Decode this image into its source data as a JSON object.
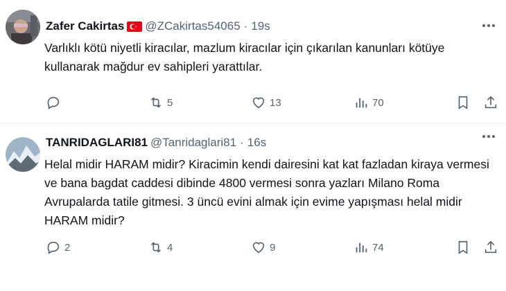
{
  "colors": {
    "text": "#0f1419",
    "muted": "#536471",
    "divider": "#eff3f4",
    "flag_red": "#e30a17"
  },
  "tweets": [
    {
      "name": "Zafer Cakirtas",
      "flag_icon": "turkey-flag-icon",
      "handle": "@ZCakirtas54065",
      "separator": "·",
      "time": "19s",
      "text": "Varlıklı kötü niyetli kiracılar, mazlum kiracılar için çıkarılan kanunları kötüye kullanarak mağdur ev sahipleri yarattılar.",
      "replies": "",
      "retweets": "5",
      "likes": "13",
      "views": "70"
    },
    {
      "name": "TANRIDAGLARI81",
      "handle": "@Tanridaglari81",
      "separator": "·",
      "time": "16s",
      "text": "Helal midir HARAM midir? Kiracimin kendi dairesini kat kat fazladan kiraya vermesi ve bana bagdat caddesi dibinde 4800 vermesi sonra yazları Milano Roma Avrupalarda tatile gitmesi. 3 üncü evini almak için evime yapışması helal midir HARAM midir?",
      "replies": "2",
      "retweets": "4",
      "likes": "9",
      "views": "74"
    }
  ]
}
